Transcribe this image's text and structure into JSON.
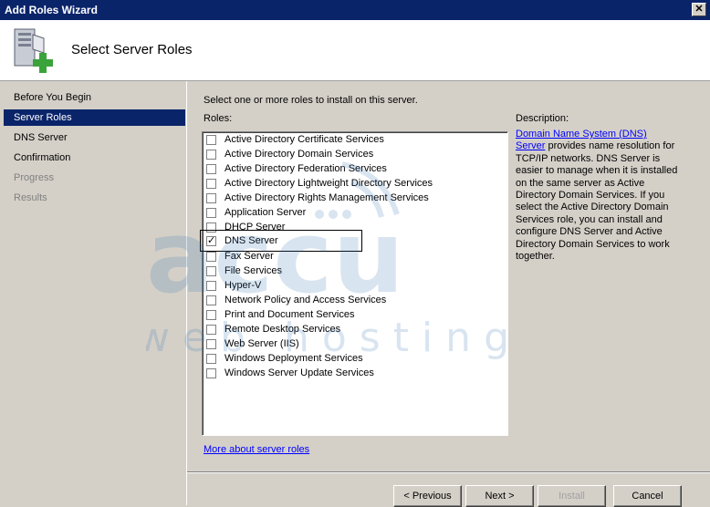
{
  "window": {
    "title": "Add Roles Wizard",
    "close_glyph": "✕"
  },
  "header": {
    "title": "Select Server Roles",
    "icon": "server-roles-icon"
  },
  "nav": {
    "items": [
      {
        "label": "Before You Begin",
        "state": "normal"
      },
      {
        "label": "Server Roles",
        "state": "selected"
      },
      {
        "label": "DNS Server",
        "state": "normal"
      },
      {
        "label": "Confirmation",
        "state": "normal"
      },
      {
        "label": "Progress",
        "state": "disabled"
      },
      {
        "label": "Results",
        "state": "disabled"
      }
    ]
  },
  "main": {
    "instruction": "Select one or more roles to install on this server.",
    "roles_label": "Roles:",
    "roles": [
      {
        "label": "Active Directory Certificate Services",
        "checked": false
      },
      {
        "label": "Active Directory Domain Services",
        "checked": false
      },
      {
        "label": "Active Directory Federation Services",
        "checked": false
      },
      {
        "label": "Active Directory Lightweight Directory Services",
        "checked": false
      },
      {
        "label": "Active Directory Rights Management Services",
        "checked": false
      },
      {
        "label": "Application Server",
        "checked": false
      },
      {
        "label": "DHCP Server",
        "checked": false
      },
      {
        "label": "DNS Server",
        "checked": true
      },
      {
        "label": "Fax Server",
        "checked": false
      },
      {
        "label": "File Services",
        "checked": false
      },
      {
        "label": "Hyper-V",
        "checked": false
      },
      {
        "label": "Network Policy and Access Services",
        "checked": false
      },
      {
        "label": "Print and Document Services",
        "checked": false
      },
      {
        "label": "Remote Desktop Services",
        "checked": false
      },
      {
        "label": "Web Server (IIS)",
        "checked": false
      },
      {
        "label": "Windows Deployment Services",
        "checked": false
      },
      {
        "label": "Windows Server Update Services",
        "checked": false
      }
    ],
    "description_label": "Description:",
    "description_link": "Domain Name System (DNS) Server",
    "description_text": "provides name resolution for TCP/IP networks. DNS Server is easier to manage when it is installed on the same server as Active Directory Domain Services. If you select the Active Directory Domain Services role, you can install and configure DNS Server and Active Directory Domain Services to work together.",
    "more_link": "More about server roles"
  },
  "buttons": {
    "previous": "< Previous",
    "next": "Next >",
    "install": "Install",
    "cancel": "Cancel"
  },
  "watermark": {
    "top": "accu",
    "bottom": "web hosting"
  },
  "colors": {
    "selected_bg": "#0a246a",
    "link": "#0000ff",
    "face": "#d4d0c8"
  }
}
